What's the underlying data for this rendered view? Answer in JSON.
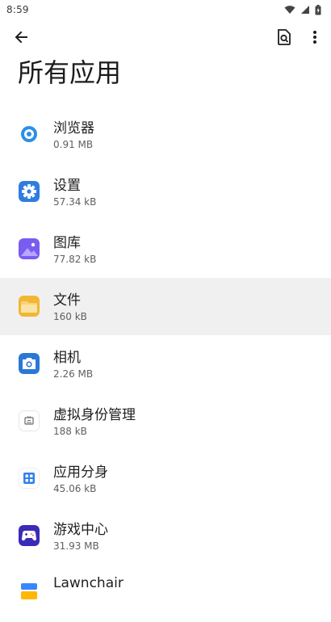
{
  "status_bar": {
    "time": "8:59"
  },
  "app_bar": {
    "title": "所有应用"
  },
  "apps": [
    {
      "name": "浏览器",
      "size": "0.91 MB",
      "icon": "browser-icon"
    },
    {
      "name": "设置",
      "size": "57.34 kB",
      "icon": "settings-icon"
    },
    {
      "name": "图库",
      "size": "77.82 kB",
      "icon": "gallery-icon"
    },
    {
      "name": "文件",
      "size": "160 kB",
      "icon": "files-icon"
    },
    {
      "name": "相机",
      "size": "2.26 MB",
      "icon": "camera-icon"
    },
    {
      "name": "虚拟身份管理",
      "size": "188 kB",
      "icon": "virtual-identity-icon"
    },
    {
      "name": "应用分身",
      "size": "45.06 kB",
      "icon": "app-clone-icon"
    },
    {
      "name": "游戏中心",
      "size": "31.93 MB",
      "icon": "game-center-icon"
    },
    {
      "name": "Lawnchair",
      "size": "",
      "icon": "lawnchair-icon"
    }
  ],
  "colors": {
    "accent_blue": "#2f80ed",
    "highlight_row": "#f0f0f0"
  }
}
